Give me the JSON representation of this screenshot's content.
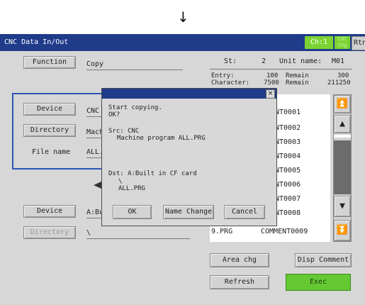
{
  "arrow": "↓",
  "window": {
    "title": "CNC Data In/Out",
    "channel": "Ch:1",
    "cnc_badge": [
      "CNC",
      "Chg"
    ],
    "return_label": "Rtn"
  },
  "function": {
    "button": "Function",
    "value": "Copy"
  },
  "status": {
    "st_label": "St:",
    "st_value": "2",
    "unit_label": "Unit name:",
    "unit_value": "M01",
    "entry_label": "Entry:",
    "entry_value": "100",
    "entry_remain_label": "Remain",
    "entry_remain_value": "300",
    "char_label": "Character:",
    "char_value": "7500",
    "char_remain_label": "Remain",
    "char_remain_value": "211250"
  },
  "source": {
    "device_button": "Device",
    "device_value": "CNC",
    "directory_button": "Directory",
    "directory_value": "Mach",
    "filename_label": "File name",
    "filename_value": "ALL."
  },
  "destination": {
    "device_button": "Device",
    "device_value": "A:Bu",
    "directory_button": "Directory",
    "directory_value": "\\"
  },
  "file_list": {
    "rows": [
      "NT0001",
      "NT0002",
      "NT0003",
      "NT0004",
      "NT0005",
      "NT0006",
      "NT0007",
      "NT0008"
    ],
    "last_row_name": "9.PRG",
    "last_row_comment": "COMMENT0009"
  },
  "scrollbar": {
    "page_up": "⏫",
    "up": "▲",
    "down": "▼",
    "page_down": "⏬"
  },
  "buttons": {
    "area_chg": "Area chg",
    "disp_comment": "Disp Comment",
    "refresh": "Refresh",
    "exec": "Exec"
  },
  "dialog": {
    "close": "×",
    "line1": "Start copying.",
    "line2": "OK?",
    "src_label": "Src: CNC",
    "src_path": "Machine program ALL.PRG",
    "dst_label": "Dst: A:Built in CF card",
    "dst_dir": "\\",
    "dst_file": "ALL.PRG",
    "ok": "OK",
    "name_change": "Name Change",
    "cancel": "Cancel"
  }
}
